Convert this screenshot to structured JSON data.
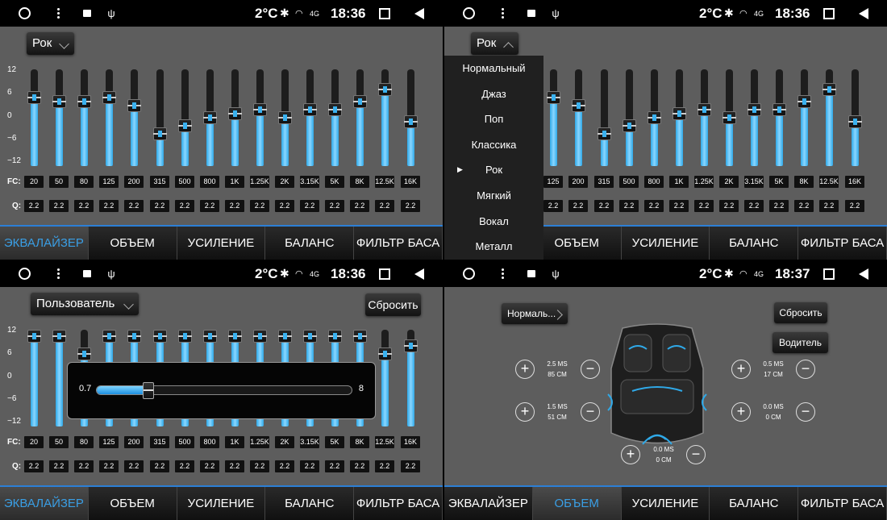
{
  "status": {
    "p1": {
      "temp": "2°C",
      "time": "18:36"
    },
    "p2": {
      "temp": "2°C",
      "time": "18:36"
    },
    "p3": {
      "temp": "2°C",
      "time": "18:36"
    },
    "p4": {
      "temp": "2°C",
      "time": "18:37"
    },
    "bt_icon": "bluetooth-icon",
    "wifi_icon": "wifi-icon",
    "signal_label": "4G"
  },
  "eq": {
    "scale": [
      "12",
      "6",
      "0",
      "−6",
      "−12"
    ],
    "fc_label": "FC:",
    "q_label": "Q:",
    "bands": [
      "20",
      "50",
      "80",
      "125",
      "200",
      "315",
      "500",
      "800",
      "1K",
      "1.25K",
      "2K",
      "3.15K",
      "5K",
      "8K",
      "12.5K",
      "16K"
    ],
    "q_values": [
      "2.2",
      "2.2",
      "2.2",
      "2.2",
      "2.2",
      "2.2",
      "2.2",
      "2.2",
      "2.2",
      "2.2",
      "2.2",
      "2.2",
      "2.2",
      "2.2",
      "2.2",
      "2.2"
    ],
    "rock_levels": [
      5,
      4,
      4,
      5,
      3,
      -4,
      -2,
      0,
      1,
      2,
      0,
      2,
      2,
      4,
      7,
      -1
    ],
    "user_levels": [
      12,
      12,
      6,
      12,
      12,
      12,
      12,
      12,
      12,
      12,
      12,
      12,
      12,
      12,
      6,
      8
    ],
    "range_max": 12
  },
  "panel1": {
    "preset": "Рок"
  },
  "panel2": {
    "preset": "Рок",
    "dropdown": [
      "Нормальный",
      "Джаз",
      "Поп",
      "Классика",
      "Рок",
      "Мягкий",
      "Вокал",
      "Металл"
    ],
    "selected_index": 4
  },
  "panel3": {
    "preset": "Пользователь",
    "reset": "Сбросить",
    "popup_min": "0.7",
    "popup_max": "8",
    "popup_value_fraction": 0.2
  },
  "panel4": {
    "preset": "Нормаль...",
    "reset": "Сбросить",
    "driver": "Водитель",
    "fl": {
      "ms": "2.5 MS",
      "cm": "85 CM"
    },
    "fr": {
      "ms": "0.5 MS",
      "cm": "17 CM"
    },
    "rl": {
      "ms": "1.5 MS",
      "cm": "51 CM"
    },
    "rr": {
      "ms": "0.0 MS",
      "cm": "0 CM"
    },
    "sub": {
      "ms": "0.0 MS",
      "cm": "0 CM"
    },
    "plus": "+",
    "minus": "−"
  },
  "tabs": [
    "ЭКВАЛАЙЗЕР",
    "ОБЪЕМ",
    "УСИЛЕНИЕ",
    "БАЛАНС",
    "ФИЛЬТР БАСА"
  ],
  "colors": {
    "accent": "#3a9ee4",
    "panel": "#5d5d5d"
  }
}
